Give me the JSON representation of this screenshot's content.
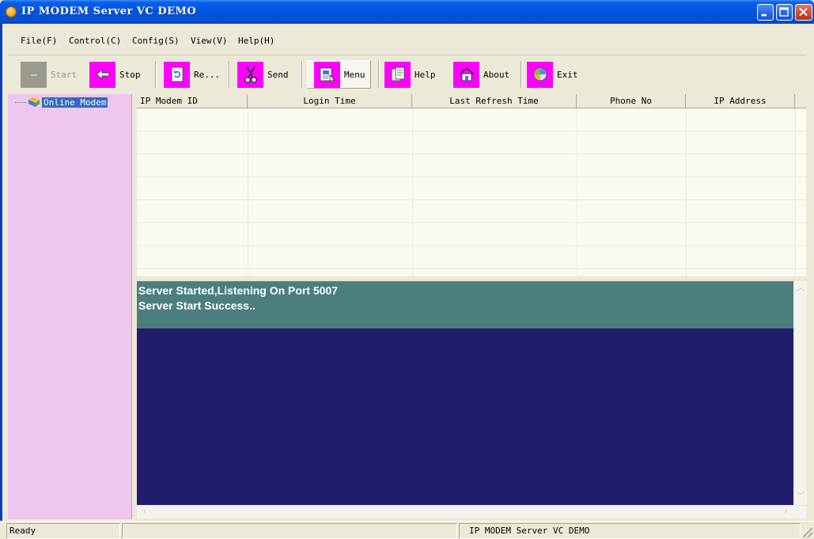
{
  "window": {
    "title": "IP MODEM Server VC DEMO",
    "icons": {
      "app": "app-icon",
      "minimize": "minimize-icon",
      "maximize": "maximize-icon",
      "close": "close-icon"
    }
  },
  "menu": {
    "items": [
      {
        "label": "File(F)"
      },
      {
        "label": "Control(C)"
      },
      {
        "label": "Config(S)"
      },
      {
        "label": "View(V)"
      },
      {
        "label": "Help(H)"
      }
    ]
  },
  "toolbar": {
    "accent_color": "#ff00ff",
    "buttons": [
      {
        "label": "Start",
        "icon": "start-icon",
        "enabled": false
      },
      {
        "label": "Stop",
        "icon": "arrow-left-icon",
        "enabled": true
      },
      {
        "label": "Re...",
        "icon": "refresh-icon",
        "enabled": true
      },
      {
        "label": "Send",
        "icon": "scissors-icon",
        "enabled": true
      },
      {
        "label": "Menu",
        "icon": "menu-icon",
        "enabled": true,
        "pressed": true
      },
      {
        "label": "Help",
        "icon": "help-icon",
        "enabled": true
      },
      {
        "label": "About",
        "icon": "home-icon",
        "enabled": true
      },
      {
        "label": "Exit",
        "icon": "exit-icon",
        "enabled": true
      }
    ]
  },
  "tree": {
    "background": "#eec6ee",
    "root": {
      "label": "Online Modem",
      "icon": "folder-icon",
      "selected": true
    }
  },
  "list": {
    "columns": [
      "IP Modem ID",
      "Login Time",
      "Last Refresh Time",
      "Phone No",
      "IP Address"
    ],
    "rows": []
  },
  "log": {
    "background": "#211c6c",
    "highlight": "#4b7f7e",
    "lines": [
      "Server Started,Listening On Port 5007",
      "Server Start Success.."
    ]
  },
  "status": {
    "left": "Ready",
    "middle": "",
    "right": "IP MODEM Server VC DEMO"
  }
}
